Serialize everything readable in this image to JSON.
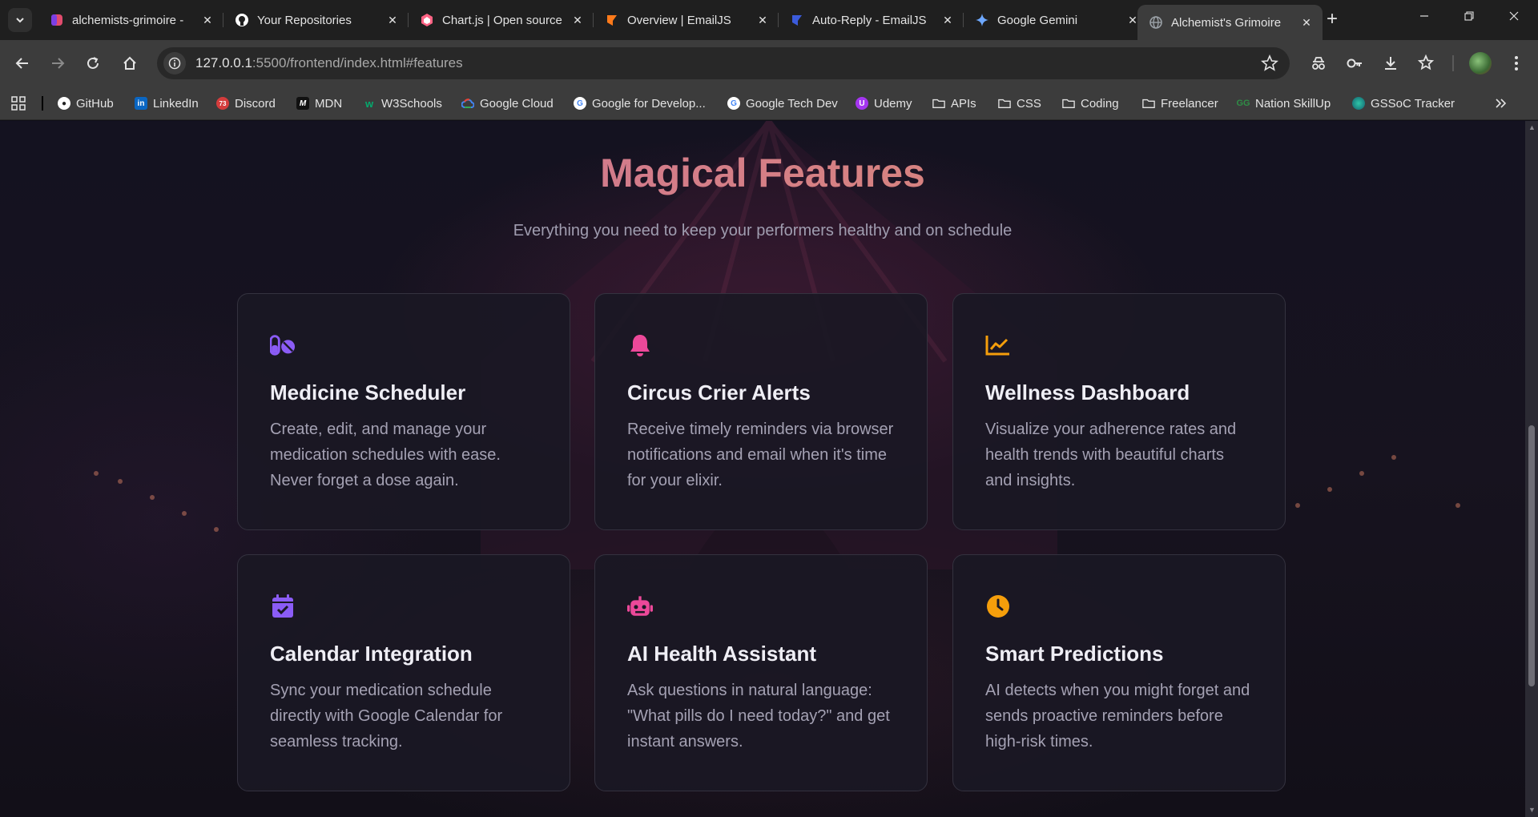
{
  "tabs": [
    {
      "title": "alchemists-grimoire -",
      "favicon": "heart-favicon",
      "color": "#e14b6d"
    },
    {
      "title": "Your Repositories",
      "favicon": "github-icon",
      "color": "#ffffff"
    },
    {
      "title": "Chart.js | Open source",
      "favicon": "chartjs-icon",
      "color": "#ff6384"
    },
    {
      "title": "Overview | EmailJS",
      "favicon": "emailjs-icon",
      "color": "#ff7a1a"
    },
    {
      "title": "Auto-Reply - EmailJS",
      "favicon": "emailjs-icon",
      "color": "#3b5bdb"
    },
    {
      "title": "Google Gemini",
      "favicon": "gemini-icon",
      "color": "#6ea8fe"
    },
    {
      "title": "Alchemist's Grimoire",
      "favicon": "globe-icon",
      "color": "#9aa0a6"
    }
  ],
  "address_bar": {
    "host": "127.0.0.1",
    "rest": ":5500/frontend/index.html#features"
  },
  "bookmarks": [
    {
      "label": "GitHub",
      "icon": "github-icon",
      "color": "#24292e"
    },
    {
      "label": "LinkedIn",
      "icon": "linkedin-icon",
      "color": "#0a66c2"
    },
    {
      "label": "Discord",
      "icon": "discord-icon",
      "color": "#d43c3c",
      "badge": "73"
    },
    {
      "label": "MDN",
      "icon": "mdn-icon",
      "color": "#111111"
    },
    {
      "label": "W3Schools",
      "icon": "w3schools-icon",
      "color": "#04aa6d"
    },
    {
      "label": "Google Cloud",
      "icon": "google-cloud-icon",
      "color": "#4285f4"
    },
    {
      "label": "Google for Develop...",
      "icon": "google-icon",
      "color": "#ffffff"
    },
    {
      "label": "Google Tech Dev",
      "icon": "google-icon",
      "color": "#ffffff"
    },
    {
      "label": "Udemy",
      "icon": "udemy-icon",
      "color": "#a435f0"
    },
    {
      "label": "APIs",
      "icon": "folder-icon",
      "color": ""
    },
    {
      "label": "CSS",
      "icon": "folder-icon",
      "color": ""
    },
    {
      "label": "Coding",
      "icon": "folder-icon",
      "color": ""
    },
    {
      "label": "Freelancer",
      "icon": "folder-icon",
      "color": ""
    },
    {
      "label": "Nation SkillUp",
      "icon": "gfg-icon",
      "color": "#2f8d46"
    },
    {
      "label": "GSSoC Tracker",
      "icon": "gssoc-icon",
      "color": "#1fa3a3"
    }
  ],
  "section": {
    "title": "Magical Features",
    "subtitle": "Everything you need to keep your performers healthy and on schedule"
  },
  "features": [
    {
      "title": "Medicine Scheduler",
      "description": "Create, edit, and manage your medication schedules with ease. Never forget a dose again.",
      "icon": "pills-icon",
      "color": "#8b5cf6"
    },
    {
      "title": "Circus Crier Alerts",
      "description": "Receive timely reminders via browser notifications and email when it's time for your elixir.",
      "icon": "bell-icon",
      "color": "#ec4899"
    },
    {
      "title": "Wellness Dashboard",
      "description": "Visualize your adherence rates and health trends with beautiful charts and insights.",
      "icon": "chart-line-icon",
      "color": "#f59e0b"
    },
    {
      "title": "Calendar Integration",
      "description": "Sync your medication schedule directly with Google Calendar for seamless tracking.",
      "icon": "calendar-check-icon",
      "color": "#8b5cf6"
    },
    {
      "title": "AI Health Assistant",
      "description": "Ask questions in natural language: \"What pills do I need today?\" and get instant answers.",
      "icon": "robot-icon",
      "color": "#ec4899"
    },
    {
      "title": "Smart Predictions",
      "description": "AI detects when you might forget and sends proactive reminders before high-risk times.",
      "icon": "clock-icon",
      "color": "#f59e0b"
    }
  ]
}
